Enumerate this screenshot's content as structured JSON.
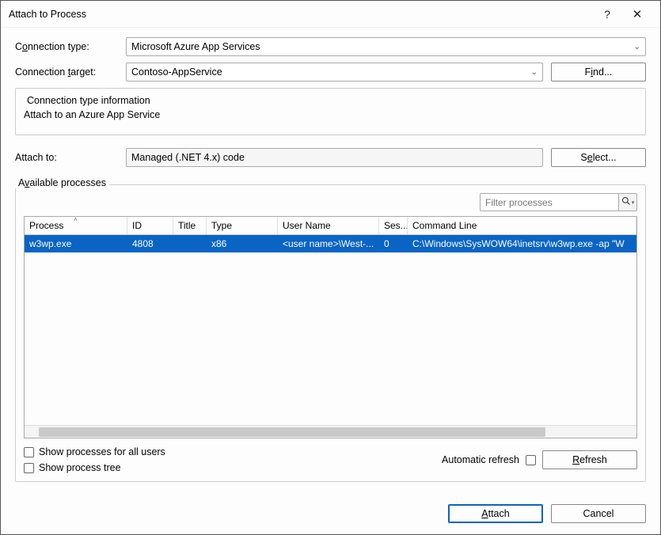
{
  "title": "Attach to Process",
  "labels": {
    "connection_type_pre": "C",
    "connection_type_ul": "o",
    "connection_type_post": "nnection type:",
    "connection_target_pre": "Connection ",
    "connection_target_ul": "t",
    "connection_target_post": "arget:",
    "attach_to": "Attach to:",
    "available_pre": "A",
    "available_ul": "v",
    "available_post": "ailable processes"
  },
  "connection_type": "Microsoft Azure App Services",
  "connection_target": "Contoso-AppService",
  "find_button_pre": "F",
  "find_button_ul": "i",
  "find_button_post": "nd...",
  "type_info_title": "Connection type information",
  "type_info_body": "Attach to an Azure App Service",
  "attach_to_value": "Managed (.NET 4.x) code",
  "select_button_pre": "S",
  "select_button_ul": "e",
  "select_button_post": "lect...",
  "filter_placeholder": "Filter processes",
  "columns": {
    "process": "Process",
    "id": "ID",
    "title": "Title",
    "type": "Type",
    "user": "User Name",
    "session": "Ses...",
    "cmd": "Command Line"
  },
  "rows": [
    {
      "process": "w3wp.exe",
      "id": "4808",
      "title": "",
      "type": "x86",
      "user": "<user name>\\West-...",
      "session": "0",
      "cmd": "C:\\Windows\\SysWOW64\\inetsrv\\w3wp.exe -ap \"W"
    }
  ],
  "checkboxes": {
    "all_users_pre": "Show processes for all ",
    "all_users_ul": "u",
    "all_users_post": "sers",
    "tree_pre": "Show process t",
    "tree_ul": "r",
    "tree_post": "ee"
  },
  "auto_refresh_label": "Automatic refresh",
  "refresh_btn_pre": "",
  "refresh_btn_ul": "R",
  "refresh_btn_post": "efresh",
  "attach_btn_pre": "",
  "attach_btn_ul": "A",
  "attach_btn_post": "ttach",
  "cancel_btn": "Cancel"
}
